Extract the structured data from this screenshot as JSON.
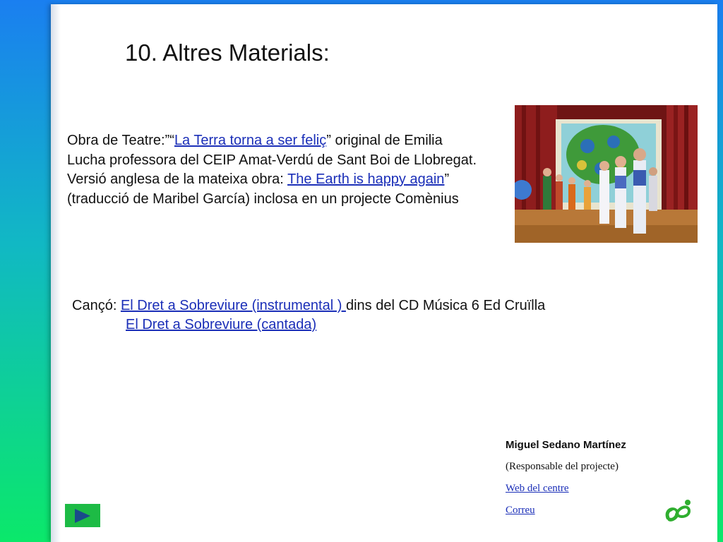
{
  "slide": {
    "title": "10. Altres Materials:",
    "play": {
      "prefix": "Obra de Teatre:”“",
      "link1": "La Terra torna a ser feliç",
      "text1": "” original de Emilia Lucha professora del CEIP Amat-Verdú de Sant Boi de Llobregat. Versió anglesa de la mateixa obra: ",
      "link2": "The Earth is happy again",
      "text2": "” (traducció de Maribel García) inclosa en un projecte Comènius"
    },
    "song": {
      "label": "Cançó: ",
      "link1": "El Dret a Sobreviure (instrumental ) ",
      "text1": "dins del CD Música 6 Ed Cruïlla",
      "link2": "El Dret a Sobreviure (cantada)"
    },
    "footer": {
      "name": "Miguel Sedano Martínez",
      "role": "(Responsable del projecte)",
      "web_link": "Web del centre",
      "mail_link": "Correu"
    }
  },
  "icons": {
    "next": "next-arrow-icon",
    "logo": "school-logo-icon"
  },
  "colors": {
    "link": "#1b2fb8",
    "nav_button": "#1dbb45",
    "nav_arrow": "#1a4a8a"
  }
}
